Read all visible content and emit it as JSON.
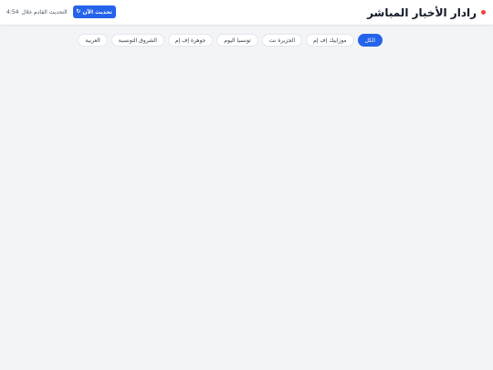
{
  "header": {
    "title": "رادار الأخبار المباشر",
    "live_indicator_color": "#ef4444",
    "next_update_label": "التحديث القادم خلال",
    "next_update_time": "4:54",
    "refresh_button_label": "تحديث الآن",
    "refresh_icon": "↻"
  },
  "filters": {
    "active_color": "#2563eb",
    "items": [
      {
        "label": "الكل",
        "active": true
      },
      {
        "label": "موزاييك إف إم",
        "active": false
      },
      {
        "label": "الجزيرة نت",
        "active": false
      },
      {
        "label": "تونسيا اليوم",
        "active": false
      },
      {
        "label": "جوهرة إف إم",
        "active": false
      },
      {
        "label": "الشروق التونسية",
        "active": false
      },
      {
        "label": "العربية",
        "active": false
      }
    ]
  }
}
